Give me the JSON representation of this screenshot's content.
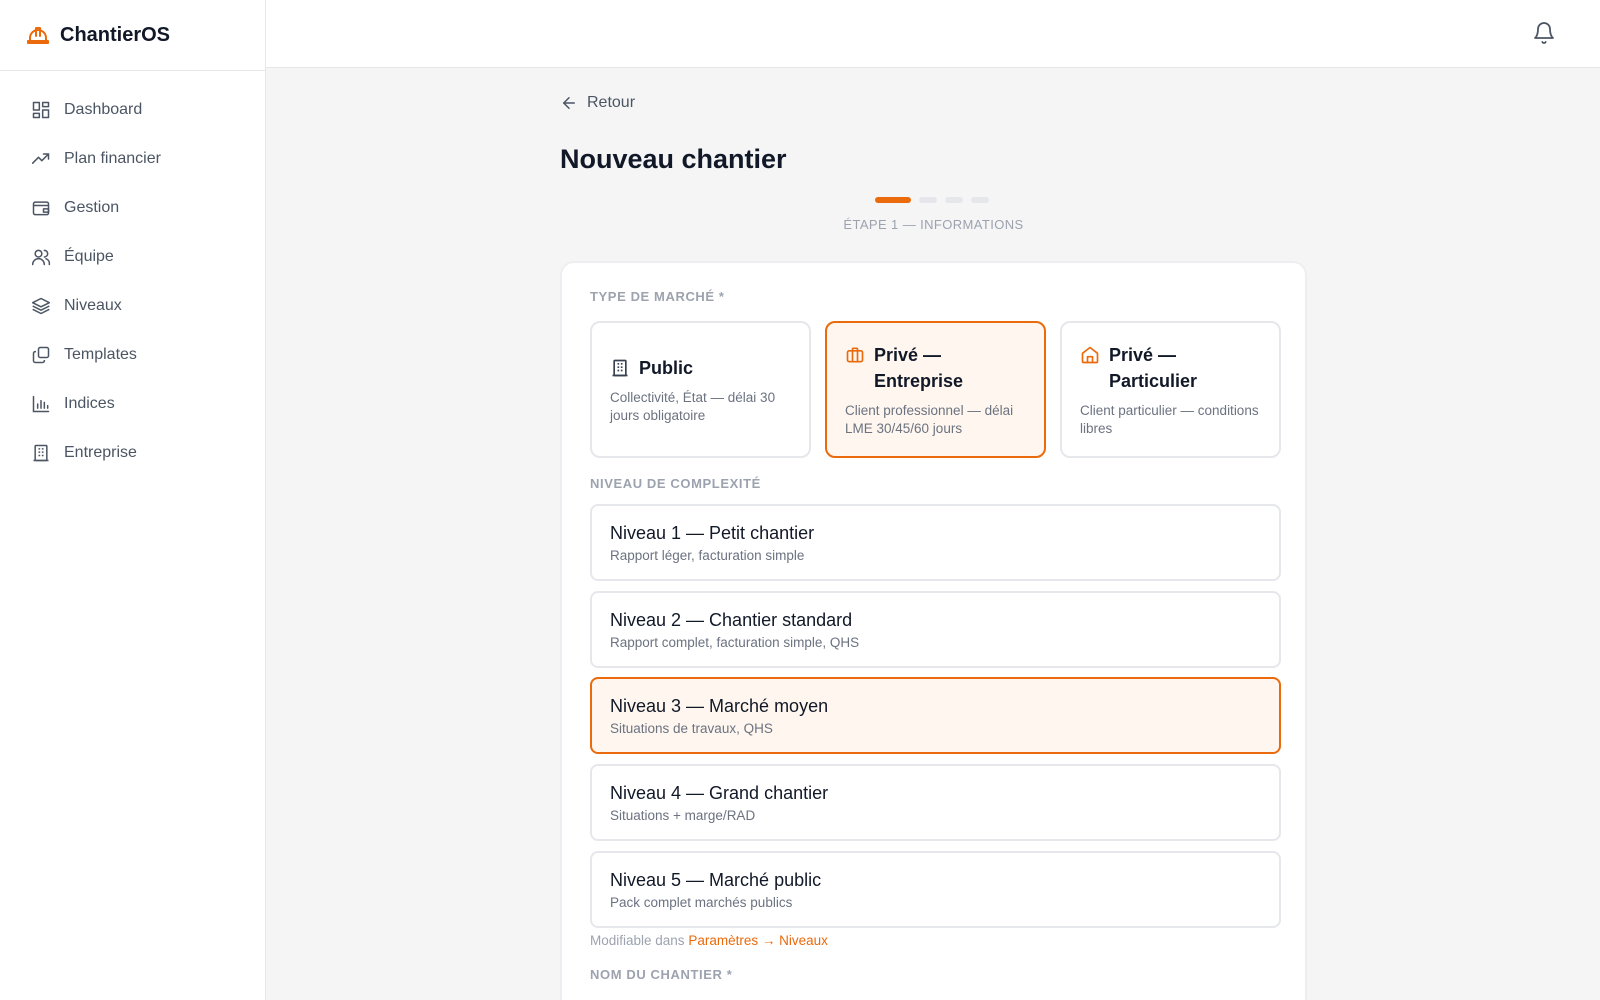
{
  "app": {
    "name": "ChantierOS"
  },
  "colors": {
    "accent": "#ea6a0c",
    "text": "#111827",
    "muted": "#6b7280",
    "border": "#e5e7eb",
    "selected_bg": "#fff7ef"
  },
  "sidebar": {
    "items": [
      {
        "label": "Dashboard",
        "icon": "dashboard-icon"
      },
      {
        "label": "Plan financier",
        "icon": "trending-up-icon"
      },
      {
        "label": "Gestion",
        "icon": "wallet-icon"
      },
      {
        "label": "Équipe",
        "icon": "users-icon"
      },
      {
        "label": "Niveaux",
        "icon": "layers-icon"
      },
      {
        "label": "Templates",
        "icon": "copy-icon"
      },
      {
        "label": "Indices",
        "icon": "bar-chart-icon"
      },
      {
        "label": "Entreprise",
        "icon": "building-icon"
      }
    ]
  },
  "topbar": {
    "bell_icon": "bell-icon"
  },
  "page": {
    "back_label": "Retour",
    "title": "Nouveau chantier",
    "step_label": "ÉTAPE 1 — INFORMATIONS",
    "step_current": 1,
    "step_total": 4
  },
  "form": {
    "market_label": "TYPE DE MARCHÉ *",
    "markets": [
      {
        "title": "Public",
        "desc": "Collectivité, État — délai 30 jours obligatoire",
        "icon": "building-icon",
        "selected": false
      },
      {
        "title": "Privé — Entreprise",
        "desc": "Client professionnel — délai LME 30/45/60 jours",
        "icon": "briefcase-icon",
        "selected": true
      },
      {
        "title": "Privé — Particulier",
        "desc": "Client particulier — conditions libres",
        "icon": "home-icon",
        "selected": false
      }
    ],
    "complexity_label": "NIVEAU DE COMPLEXITÉ",
    "levels": [
      {
        "title": "Niveau 1 — Petit chantier",
        "desc": "Rapport léger, facturation simple",
        "selected": false
      },
      {
        "title": "Niveau 2 — Chantier standard",
        "desc": "Rapport complet, facturation simple, QHS",
        "selected": false
      },
      {
        "title": "Niveau 3 — Marché moyen",
        "desc": "Situations de travaux, QHS",
        "selected": true
      },
      {
        "title": "Niveau 4 — Grand chantier",
        "desc": "Situations + marge/RAD",
        "selected": false
      },
      {
        "title": "Niveau 5 — Marché public",
        "desc": "Pack complet marchés publics",
        "selected": false
      }
    ],
    "hint_prefix": "Modifiable dans",
    "hint_link": "Paramètres → Niveaux",
    "name_label": "NOM DU CHANTIER *"
  }
}
